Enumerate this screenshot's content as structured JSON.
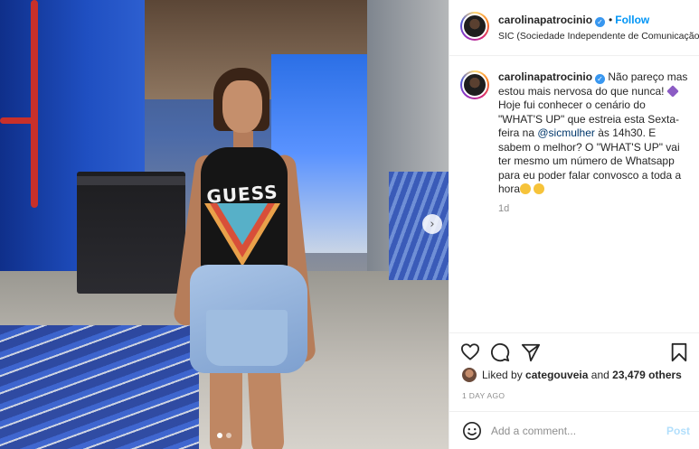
{
  "post": {
    "username": "carolinapatrocinio",
    "follow_label": "Follow",
    "separator": "•",
    "location": "SIC (Sociedade Independente de Comunicação)",
    "caption": {
      "part1": " Não pareço mas estou mais nervosa do que nunca! ",
      "part2": " Hoje fui conhecer o cenário do \"WHAT'S UP\" que estreia esta Sexta-feira na ",
      "mention": "@sicmulher",
      "part3": " às 14h30. E sabem o melhor? O \"WHAT'S UP\" vai ter mesmo um número de Whatsapp para eu poder falar convosco a toda a hora"
    },
    "caption_time": "1d",
    "photo_logo_text": "GUESS",
    "carousel": {
      "current": 1,
      "total": 2
    },
    "likes": {
      "prefix": "Liked by",
      "user": "categouveia",
      "middle": "and",
      "count": "23,479 others"
    },
    "date": "1 DAY AGO",
    "comment": {
      "placeholder": "Add a comment...",
      "post_label": "Post"
    }
  },
  "icons": {
    "verified": "verified-badge-icon",
    "heart": "heart-icon",
    "comment": "comment-icon",
    "share": "paper-plane-icon",
    "save": "bookmark-icon",
    "emoji": "smiley-icon",
    "next": "chevron-right-icon"
  },
  "colors": {
    "accent": "#0095f6",
    "post_disabled": "#b2dffc",
    "text": "#262626",
    "muted": "#8e8e8e",
    "mention": "#00376b"
  }
}
